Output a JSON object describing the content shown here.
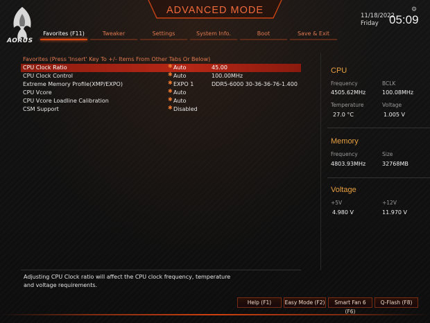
{
  "header": {
    "brand_logo": "aorus-eagle-logo",
    "brand_text": "AORUS",
    "mode_title": "ADVANCED MODE",
    "date": "11/18/2022",
    "day": "Friday",
    "time": "05:09"
  },
  "tabs": [
    {
      "label": "Favorites (F11)",
      "active": true
    },
    {
      "label": "Tweaker",
      "active": false
    },
    {
      "label": "Settings",
      "active": false
    },
    {
      "label": "System Info.",
      "active": false
    },
    {
      "label": "Boot",
      "active": false
    },
    {
      "label": "Save & Exit",
      "active": false
    }
  ],
  "favorites": {
    "title": "Favorites (Press 'Insert' Key To +/- Items From Other Tabs Or Below)",
    "rows": [
      {
        "label": "CPU Clock Ratio",
        "value": "Auto",
        "extra": "45.00",
        "selected": true
      },
      {
        "label": "CPU Clock Control",
        "value": "Auto",
        "extra": "100.00MHz",
        "selected": false
      },
      {
        "label": "Extreme Memory Profile(XMP/EXPO)",
        "value": "EXPO 1",
        "extra": "DDR5-6000 30-36-36-76-1.400",
        "selected": false
      },
      {
        "label": "CPU Vcore",
        "value": "Auto",
        "extra": "",
        "selected": false
      },
      {
        "label": "CPU Vcore Loadline Calibration",
        "value": "Auto",
        "extra": "",
        "selected": false
      },
      {
        "label": "CSM Support",
        "value": "Disabled",
        "extra": "",
        "selected": false
      }
    ]
  },
  "monitor": {
    "cpu": {
      "title": "CPU",
      "frequency_label": "Frequency",
      "frequency": "4505.62MHz",
      "bclk_label": "BCLK",
      "bclk": "100.08MHz",
      "temperature_label": "Temperature",
      "temperature": "27.0 °C",
      "voltage_label": "Voltage",
      "voltage": "1.005 V"
    },
    "memory": {
      "title": "Memory",
      "frequency_label": "Frequency",
      "frequency": "4803.93MHz",
      "size_label": "Size",
      "size": "32768MB"
    },
    "voltage": {
      "title": "Voltage",
      "p5v_label": "+5V",
      "p5v": "4.980 V",
      "p12v_label": "+12V",
      "p12v": "11.970 V"
    }
  },
  "help_text": "Adjusting CPU Clock ratio will affect the CPU clock frequency, temperature and voltage requirements.",
  "buttons": {
    "help": "Help (F1)",
    "easy_mode": "Easy Mode (F2)",
    "smart_fan": "Smart Fan 6 (F6)",
    "qflash": "Q-Flash (F8)"
  },
  "colors": {
    "accent": "#e04a10",
    "tab_text": "#e07a50",
    "section_title": "#e8a040",
    "selected_row": "#b52716"
  }
}
